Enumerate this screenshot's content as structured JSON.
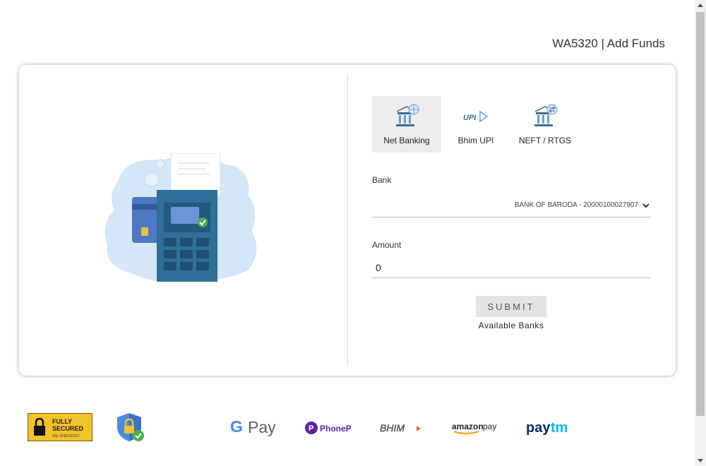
{
  "header": {
    "title": "WA5320 | Add Funds"
  },
  "payment_methods": [
    {
      "label": "Net Banking",
      "icon": "bank-globe-icon",
      "active": true
    },
    {
      "label": "Bhim UPI",
      "icon": "upi-logo-icon",
      "active": false
    },
    {
      "label": "NEFT / RTGS",
      "icon": "bank-transfer-icon",
      "active": false
    }
  ],
  "form": {
    "bank_label": "Bank",
    "bank_value": "BANK OF BARODA - 20000100027907",
    "amount_label": "Amount",
    "amount_value": "0",
    "submit_label": "SUBMIT",
    "available_banks": "Available Banks"
  },
  "footer": {
    "ssl_badge": {
      "line1": "FULLY",
      "line2": "SECURED",
      "line3": "SSL CHECKOUT"
    },
    "logos": [
      "G Pay",
      "PhonePe",
      "BHIM",
      "amazon pay",
      "paytm"
    ]
  },
  "colors": {
    "accent_blue": "#2f6f9a",
    "illustration_light": "#cfe4f7",
    "ssl_yellow": "#f3c12a",
    "check_green": "#4caf50"
  }
}
